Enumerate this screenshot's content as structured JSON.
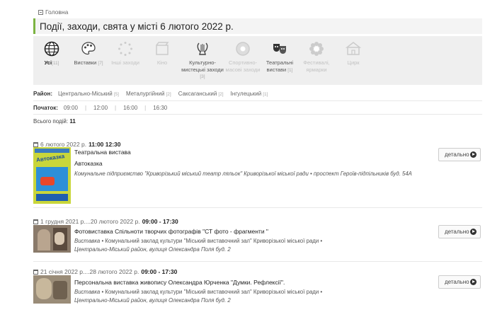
{
  "breadcrumb": {
    "home": "Головна"
  },
  "page": {
    "title": "Події, заходи, свята у місті 6 лютого 2022 р."
  },
  "categories": [
    {
      "label": "Усі",
      "count": "[11]",
      "icon": "globe-icon",
      "state": "active"
    },
    {
      "label": "Виставки",
      "count": "[7]",
      "icon": "palette-icon",
      "state": "normal"
    },
    {
      "label": "Інші заходи",
      "count": "",
      "icon": "dots-circle-icon",
      "state": "dim"
    },
    {
      "label": "Кіно",
      "count": "",
      "icon": "film-icon",
      "state": "dim"
    },
    {
      "label": "Культурно-мистецькі заходи",
      "count": "[3]",
      "icon": "lyre-icon",
      "state": "normal"
    },
    {
      "label": "Спортивно-масові заходи",
      "count": "",
      "icon": "ball-icon",
      "state": "dim"
    },
    {
      "label": "Театральні вистави",
      "count": "[1]",
      "icon": "theatre-masks-icon",
      "state": "normal"
    },
    {
      "label": "Фестивалі, ярмарки",
      "count": "",
      "icon": "flower-icon",
      "state": "dim"
    },
    {
      "label": "Цирк",
      "count": "",
      "icon": "circus-tent-icon",
      "state": "dim"
    }
  ],
  "district_filter": {
    "label": "Район:",
    "options": [
      {
        "name": "Центрально-Міський",
        "count": "[5]"
      },
      {
        "name": "Металургійний",
        "count": "[2]"
      },
      {
        "name": "Саксаганський",
        "count": "[2]"
      },
      {
        "name": "Інгулецький",
        "count": "[1]"
      }
    ]
  },
  "time_filter": {
    "label": "Початок:",
    "times": [
      "09:00",
      "12:00",
      "16:00",
      "16:30"
    ]
  },
  "total": {
    "label": "Всього подій:",
    "value": "11"
  },
  "more_label": "детально",
  "events": [
    {
      "date": "6 лютого 2022 р.",
      "time": "11:00 12:30",
      "subtitle": "Театральна вистава",
      "title": "Автоказка",
      "meta": "Комунальне підприємство \"Криворізький міський театр ляльок\" Криворізької міської ради • проспект Героїв-підпільників буд. 54А",
      "thumb_headline": "Автоказка"
    },
    {
      "date": "1 грудня 2021 р....20 лютого 2022 р.",
      "time": "09:00 - 17:30",
      "title": "Фотовиставка Спільноти творчих фотографів \"СТ фото - фрагменти \"",
      "meta_type": "Виставка",
      "meta_org": "Комунальний заклад культури \"Міський виставочний зал\" Криворізької міської ради",
      "meta_addr": "Центрально-Міський район, вулиця Олександра Поля буд. 2"
    },
    {
      "date": "21 січня 2022 р....28 лютого 2022 р.",
      "time": "09:00 - 17:30",
      "title": "Персональна виставка живопису Олександра Юрченка \"Думки. Рефлексії\".",
      "meta_type": "Виставка",
      "meta_org": "Комунальний заклад культури \"Міський виставочний зал\" Криворізької міської ради",
      "meta_addr": "Центрально-Міський район, вулиця Олександра Поля буд. 2"
    }
  ]
}
